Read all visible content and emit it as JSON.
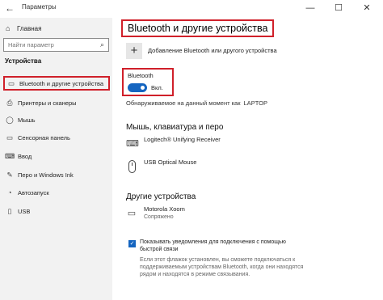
{
  "window": {
    "title": "Параметры",
    "back_glyph": "←",
    "minimize_glyph": "—",
    "maximize_glyph": "☐",
    "close_glyph": "✕"
  },
  "sidebar": {
    "home_label": "Главная",
    "search_placeholder": "Найти параметр",
    "section_title": "Устройства",
    "items": [
      {
        "label": "Bluetooth и другие устройства",
        "icon": "bluetooth-devices-icon",
        "glyph": "▭",
        "active": true
      },
      {
        "label": "Принтеры и сканеры",
        "icon": "printer-icon",
        "glyph": "⎙",
        "active": false
      },
      {
        "label": "Мышь",
        "icon": "mouse-icon",
        "glyph": "◯",
        "active": false
      },
      {
        "label": "Сенсорная панель",
        "icon": "touchpad-icon",
        "glyph": "▭",
        "active": false
      },
      {
        "label": "Ввод",
        "icon": "keyboard-icon",
        "glyph": "⌨",
        "active": false
      },
      {
        "label": "Перо и Windows Ink",
        "icon": "pen-icon",
        "glyph": "✎",
        "active": false
      },
      {
        "label": "Автозапуск",
        "icon": "autoplay-icon",
        "glyph": "◔",
        "active": false
      },
      {
        "label": "USB",
        "icon": "usb-icon",
        "glyph": "▯",
        "active": false
      }
    ]
  },
  "main": {
    "title": "Bluetooth и другие устройства",
    "add_device_label": "Добавление Bluetooth или другого устройства",
    "bluetooth": {
      "label": "Bluetooth",
      "toggle_state": "on",
      "toggle_label": "Вкл."
    },
    "discoverable_text": "Обнаруживаемое на данный момент как",
    "discoverable_name": "LAPTOP",
    "sections": [
      {
        "heading": "Мышь, клавиатура и перо",
        "devices": [
          {
            "name": "Logitech® Unifying Receiver",
            "status": "",
            "icon": "keyboard-icon"
          },
          {
            "name": "USB Optical Mouse",
            "status": "",
            "icon": "mouse-icon"
          }
        ]
      },
      {
        "heading": "Другие устройства",
        "devices": [
          {
            "name": "Motorola Xoom",
            "status": "Сопряжено",
            "icon": "tablet-icon"
          }
        ]
      }
    ],
    "notification_checkbox": {
      "checked": true,
      "label": "Показывать уведомления для подключения с помощью быстрой связи"
    },
    "note": "Если этот флажок установлен, вы сможете подключаться к поддерживаемым устройствам Bluetooth, когда они находятся рядом и находятся в режиме связывания."
  },
  "colors": {
    "highlight_border": "#d0202a",
    "accent": "#1565c0",
    "sidebar_bg": "#f2f2f2"
  }
}
